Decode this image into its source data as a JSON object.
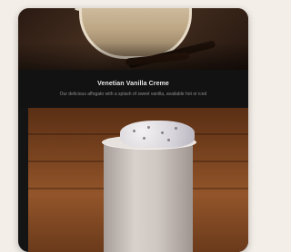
{
  "card": {
    "title": "Venetian Vanilla Creme",
    "description": "Our delicious affogato with a splash of sweet vanilla, available hot or iced"
  },
  "colors": {
    "card_background": "#141414",
    "title_text": "#e8e8e8",
    "description_text": "#8c8c8c",
    "page_background": "#f4eee8"
  },
  "images": {
    "top_photo": "vanilla-drink-photo",
    "bottom_photo": "iced-vanilla-creme-photo"
  }
}
